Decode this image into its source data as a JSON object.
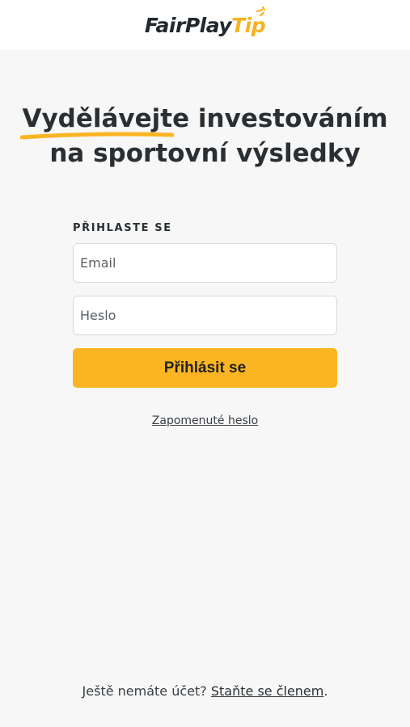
{
  "header": {
    "logo_part1": "FairPlay",
    "logo_part2": "Tip"
  },
  "hero": {
    "highlight": "Vydělávejte",
    "line1_rest": " investováním",
    "line2": "na sportovní výsledky"
  },
  "login": {
    "section_label": "PŘIHLASTE SE",
    "email_placeholder": "Email",
    "password_placeholder": "Heslo",
    "submit_label": "Přihlásit se",
    "forgot_label": "Zapomenuté heslo"
  },
  "footer": {
    "prompt": "Ještě nemáte účet? ",
    "signup_label": "Staňte se členem",
    "period": "."
  },
  "colors": {
    "accent": "#fbb522",
    "background": "#f7f7f7",
    "text": "#2a2f33"
  }
}
